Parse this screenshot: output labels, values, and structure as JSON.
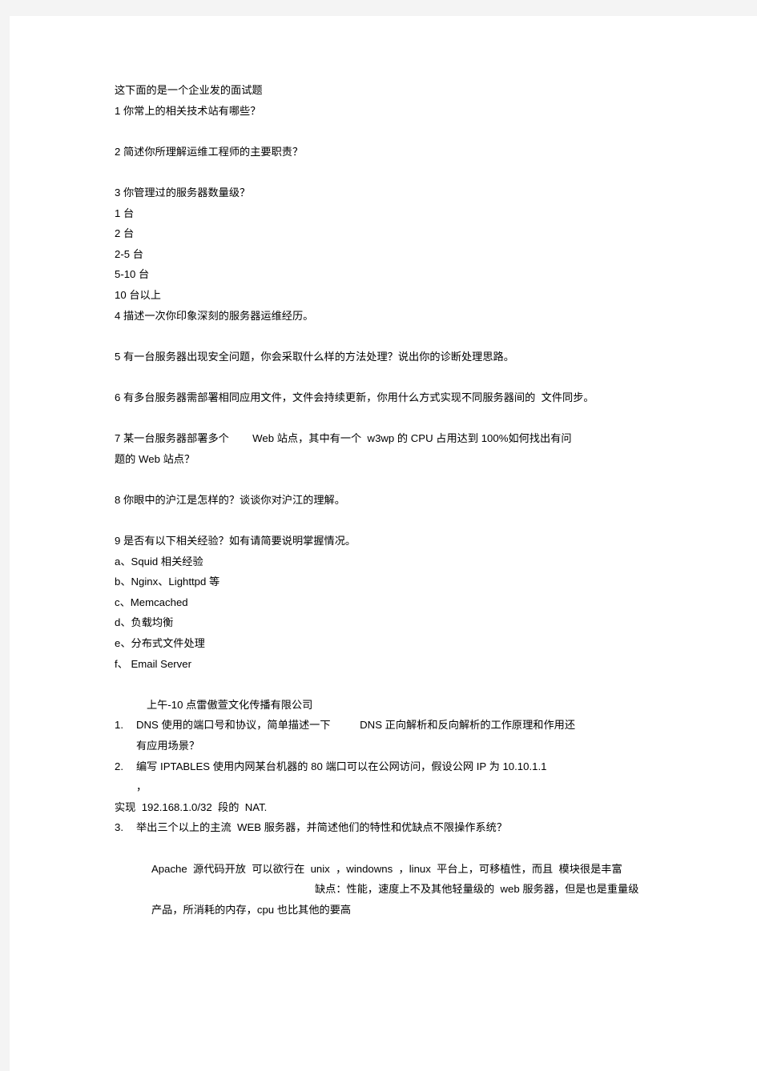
{
  "document": {
    "intro": "这下面的是一个企业发的面试题",
    "section1": {
      "q1": "1 你常上的相关技术站有哪些？",
      "q2": "2 简述你所理解运维工程师的主要职责？",
      "q3": "3 你管理过的服务器数量级？",
      "q3_options": [
        "1 台",
        "2 台",
        "2-5 台",
        "5-10 台",
        "10 台以上"
      ],
      "q4": "4 描述一次你印象深刻的服务器运维经历。",
      "q5": "5 有一台服务器出现安全问题，你会采取什么样的方法处理？说出你的诊断处理思路。",
      "q6": "6 有多台服务器需部署相同应用文件，文件会持续更新，你用什么方式实现不同服务器间的  文件同步。",
      "q7_line1": "7 某一台服务器部署多个        Web 站点，其中有一个  w3wp 的 CPU 占用达到 100%如何找出有问",
      "q7_line2": "题的 Web 站点？",
      "q8": "8 你眼中的沪江是怎样的？谈谈你对沪江的理解。",
      "q9": "9 是否有以下相关经验？如有请简要说明掌握情况。",
      "q9_options": [
        "a、Squid 相关经验",
        "b、Nginx、Lighttpd 等",
        "c、Memcached",
        "d、负载均衡",
        "e、分布式文件处理",
        "f、 Email Server"
      ]
    },
    "section2": {
      "company_line": "上午-10 点雷傲萱文化传播有限公司",
      "items": [
        {
          "marker": "1.",
          "lines": [
            "DNS 使用的端口号和协议，简单描述一下          DNS 正向解析和反向解析的工作原理和作用还",
            "有应用场景？"
          ]
        },
        {
          "marker": "2.",
          "lines": [
            "编写 IPTABLES 使用内网某台机器的 80 端口可以在公网访问，假设公网 IP 为 10.10.1.1",
            "，"
          ]
        }
      ],
      "nat_line": "实现  192.168.1.0/32  段的  NAT.",
      "item3": {
        "marker": "3.",
        "text": "举出三个以上的主流  WEB 服务器，并简述他们的特性和优缺点不限操作系统？"
      },
      "apache": {
        "line1": "Apache  源代码开放  可以欲行在  unix  ，windowns  ，linux  平台上，可移植性，而且  模块很是丰富",
        "line2": "缺点：性能，速度上不及其他轻量级的  web 服务器，但是也是重量级",
        "line3": "产品，所消耗的内存，cpu 也比其他的要高"
      }
    }
  }
}
